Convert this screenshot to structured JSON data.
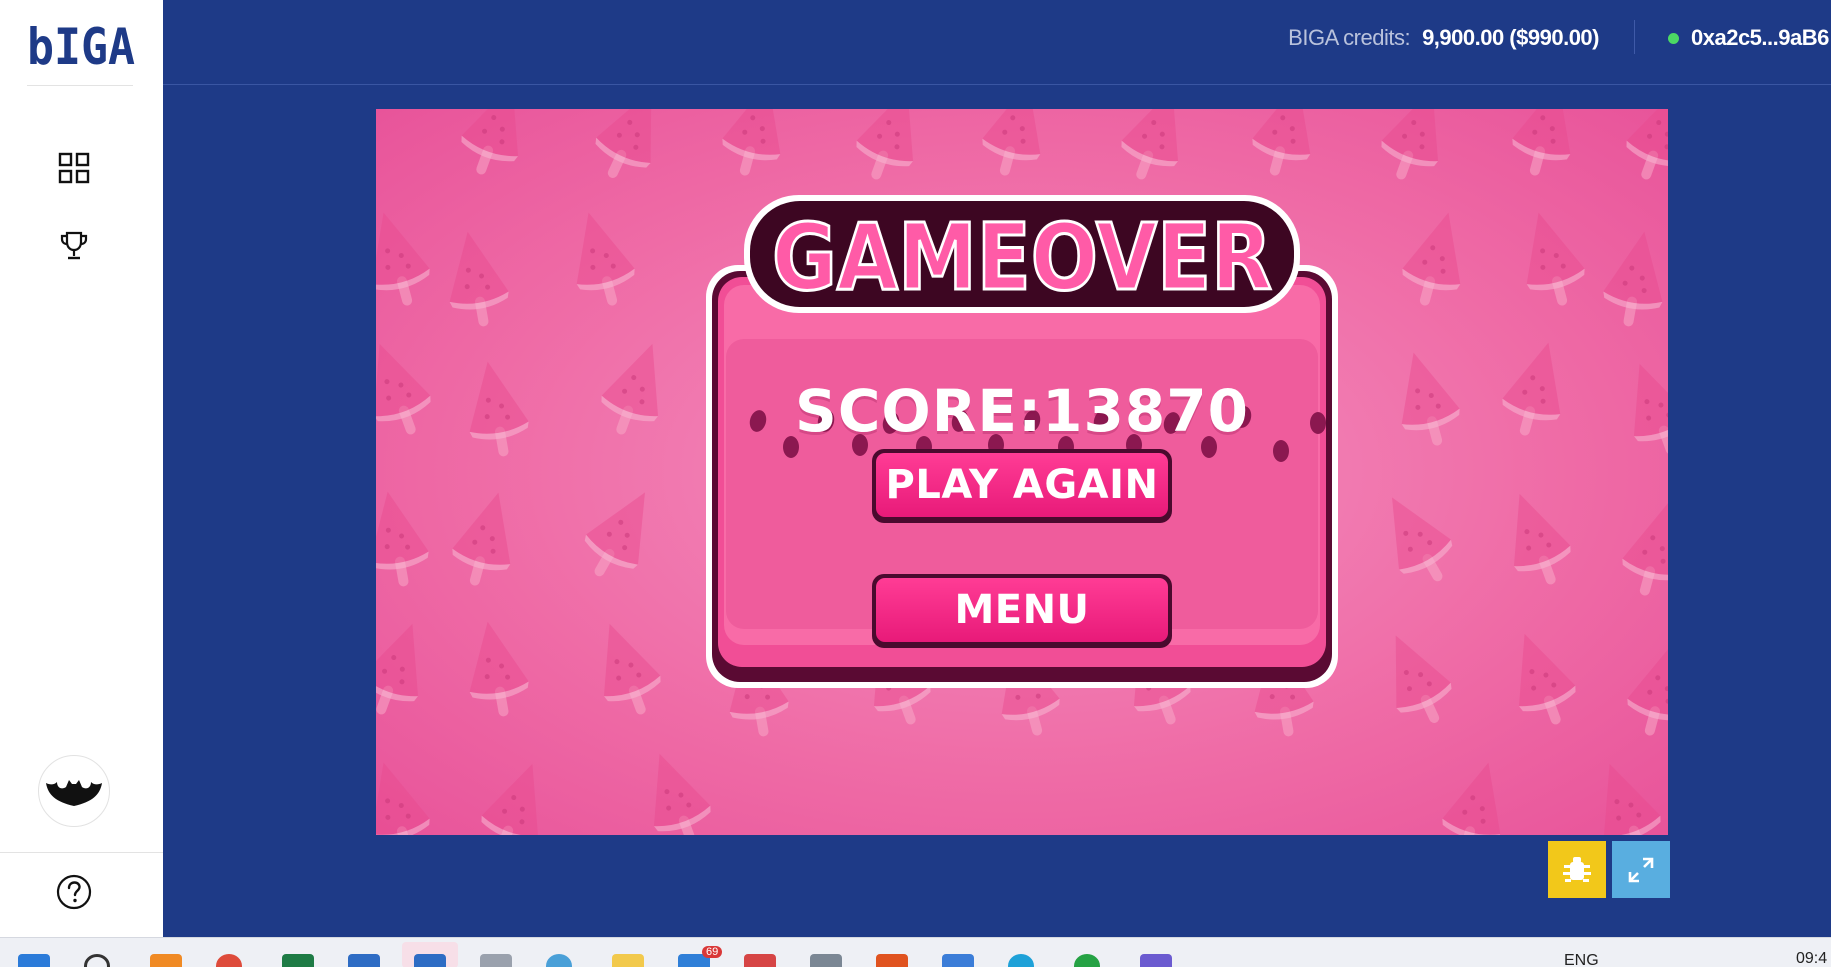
{
  "brand": {
    "logo_text": "bIGA"
  },
  "sidebar": {
    "items": [
      {
        "icon": "grid-icon",
        "label": "Games"
      },
      {
        "icon": "trophy-icon",
        "label": "Leaderboard"
      }
    ],
    "avatar_icon": "bat-avatar-icon",
    "help_icon": "help-icon"
  },
  "header": {
    "credits_label": "BIGA credits:",
    "credits_value": "9,900.00 ($990.00)",
    "wallet_address": "0xa2c5...9aB6"
  },
  "game": {
    "title": "GAMEOVER",
    "score_text": "SCORE:13870",
    "play_again_label": "PLAY AGAIN",
    "menu_label": "MENU"
  },
  "controls": {
    "bug_icon": "bug-icon",
    "fullscreen_icon": "expand-icon"
  },
  "taskbar": {
    "badge": "69",
    "language": "ENG",
    "time": "09:4"
  },
  "colors": {
    "page_bg": "#1e3a87",
    "sidebar_bg": "#ffffff",
    "game_pink": "#ef6ba6",
    "button_pink": "#e81a79",
    "bug_button": "#f2c81a",
    "fullscreen_button": "#59aee0",
    "online_dot": "#4cd964"
  }
}
